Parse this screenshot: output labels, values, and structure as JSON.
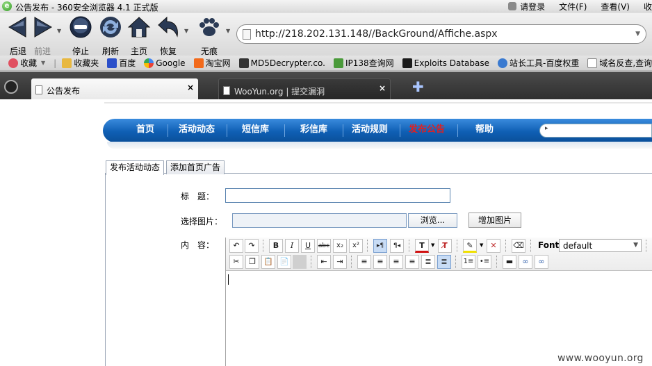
{
  "titlebar": {
    "title": "公告发布 - 360安全浏览器 4.1 正式版",
    "menus": [
      "请登录",
      "文件(F)",
      "查看(V)",
      "收"
    ]
  },
  "nav_buttons": {
    "back": "后退",
    "forward": "前进",
    "stop": "停止",
    "refresh": "刷新",
    "home": "主页",
    "restore": "恢复",
    "private": "无痕"
  },
  "address": {
    "url": "http://218.202.131.148//BackGround/Affiche.aspx"
  },
  "favorites": [
    "收藏",
    "收藏夹",
    "百度",
    "Google",
    "淘宝网",
    "MD5Decrypter.co.",
    "IP138查询网",
    "Exploits Database",
    "站长工具-百度权重",
    "域名反查,查询服务"
  ],
  "tabs": [
    {
      "title": "公告发布",
      "close": "×"
    },
    {
      "title": "WooYun.org | 提交漏洞",
      "close": "×"
    }
  ],
  "site_nav": {
    "items": [
      "首页",
      "活动动态",
      "短信库",
      "彩信库",
      "活动规则",
      "发布公告",
      "帮助"
    ],
    "active_index": 5,
    "accent_color": "#e02020"
  },
  "content_tabs": [
    "发布活动动态",
    "添加首页广告"
  ],
  "form": {
    "title_label": "标　题：",
    "image_label": "选择图片：",
    "content_label": "内　容：",
    "browse_button": "浏览...",
    "add_image_button": "增加图片"
  },
  "editor": {
    "font_label": "Font",
    "font_value": "default"
  },
  "watermark": "www.wooyun.org"
}
